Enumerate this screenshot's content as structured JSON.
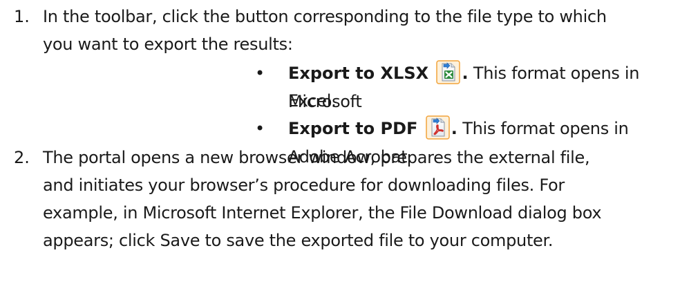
{
  "steps": [
    {
      "number": "1.",
      "text_line1": "In the toolbar, click the button corresponding to the file type to which",
      "text_line2": "you want to export the results:",
      "bullets": [
        {
          "bold_label": "Export to XLSX",
          "icon": "excel-export-icon",
          "period": ".",
          "text_line1": " This format opens in Microsoft",
          "text_line2": "Excel."
        },
        {
          "bold_label": "Export to PDF",
          "icon": "pdf-export-icon",
          "period": ".",
          "text_line1": " This format opens in Adobe Acrobat."
        }
      ]
    },
    {
      "number": "2.",
      "lines": [
        "The portal opens a new browser window, prepares the external file,",
        "and initiates your browser’s procedure for downloading files. For",
        "example, in Microsoft Internet Explorer, the File Download dialog box",
        "appears; click Save to save the exported file to your computer."
      ]
    }
  ],
  "colors": {
    "text": "#1a1a1a",
    "excel_green": "#2e8b3d",
    "pdf_red": "#d0312d",
    "icon_frame": "#f2a33a",
    "arrow_blue": "#2f7fd6"
  }
}
